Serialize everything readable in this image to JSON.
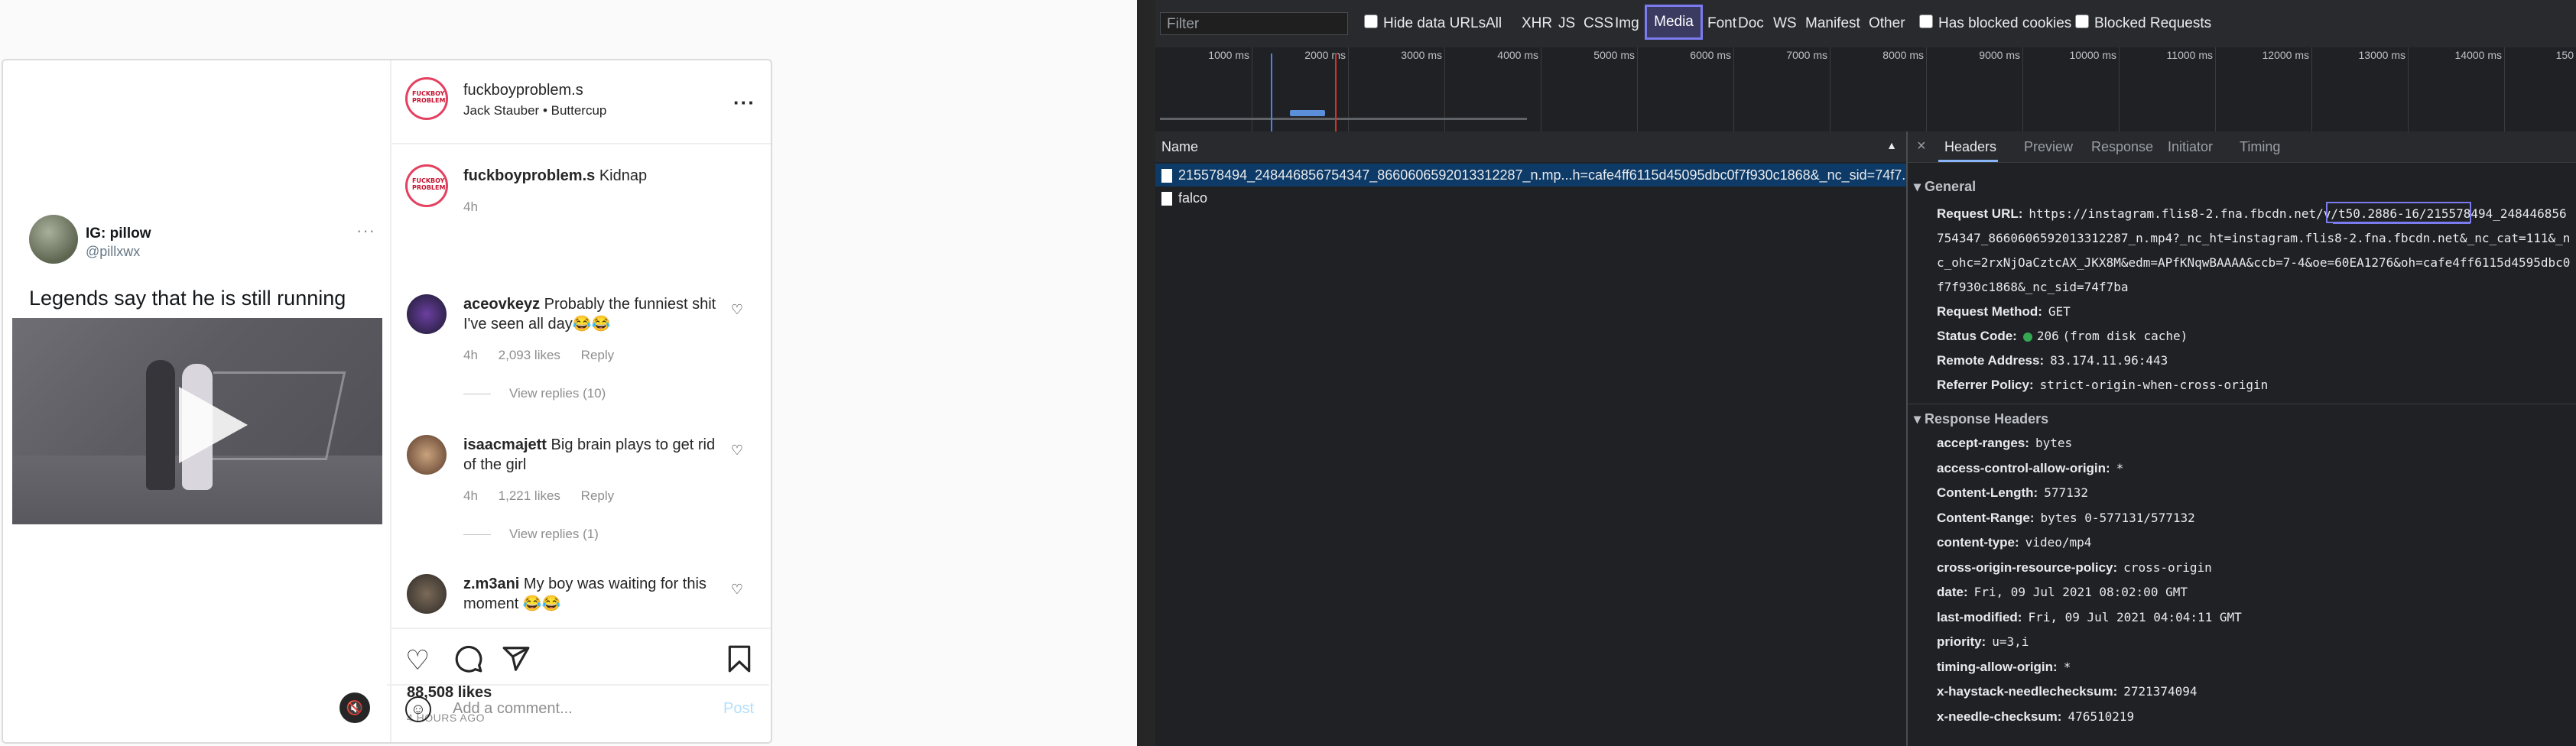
{
  "instagram": {
    "tweet": {
      "name": "IG: pillow",
      "handle": "@pillxwx",
      "more": "···",
      "text": "Legends say that he is still running"
    },
    "header": {
      "username": "fuckboyproblem.s",
      "subtitle": "Jack Stauber • Buttercup",
      "logo_text": "FUCKBOY PROBLEMS",
      "more": "···"
    },
    "caption": {
      "username": "fuckboyproblem.s",
      "text": "Kidnap",
      "time": "4h"
    },
    "comments": [
      {
        "username": "aceovkeyz",
        "text": "Probably the funniest shit I've seen all day😂😂",
        "time": "4h",
        "likes": "2,093 likes",
        "reply": "Reply",
        "replies": "View replies (10)"
      },
      {
        "username": "isaacmajett",
        "text": "Big brain plays to get rid of the girl",
        "time": "4h",
        "likes": "1,221 likes",
        "reply": "Reply",
        "replies": "View replies (1)"
      },
      {
        "username": "z.m3ani",
        "text": "My boy was waiting for this moment 😂😂"
      }
    ],
    "likes_count": "88,508 likes",
    "posted": "4 HOURS AGO",
    "add_comment_placeholder": "Add a comment...",
    "post_button": "Post",
    "icons": [
      "heart-icon",
      "comment-icon",
      "share-icon",
      "bookmark-icon",
      "emoji-icon",
      "mute-icon",
      "play-icon"
    ]
  },
  "devtools": {
    "filter_placeholder": "Filter",
    "hide_data_urls": "Hide data URLs",
    "type_filters": [
      "All",
      "XHR",
      "JS",
      "CSS",
      "Img",
      "Media",
      "Font",
      "Doc",
      "WS",
      "Manifest",
      "Other"
    ],
    "active_filter": "Media",
    "has_blocked_cookies": "Has blocked cookies",
    "blocked_requests": "Blocked Requests",
    "timeline_ticks": [
      "1000 ms",
      "2000 ms",
      "3000 ms",
      "4000 ms",
      "5000 ms",
      "6000 ms",
      "7000 ms",
      "8000 ms",
      "9000 ms",
      "10000 ms",
      "11000 ms",
      "12000 ms",
      "13000 ms",
      "14000 ms",
      "150"
    ],
    "list_header": "Name",
    "sort_glyph": "▲",
    "requests": [
      "215578494_248446856754347_8660606592013312287_n.mp...h=cafe4ff6115d45095dbc0f7f930c1868&_nc_sid=74f7...",
      "falco"
    ],
    "tabs": [
      "Headers",
      "Preview",
      "Response",
      "Initiator",
      "Timing"
    ],
    "active_tab": "Headers",
    "close_glyph": "×",
    "general_title": "General",
    "general": {
      "request_url_label": "Request URL:",
      "request_url": "https://instagram.flis8-2.fna.fbcdn.net/v/t50.2886-16/215578494_248446856754347_8660606592013312287_n.mp4?_nc_ht=instagram.flis8-2.fna.fbcdn.net&_nc_cat=111&_nc_ohc=2rxNjOaCztcAX_JKX8M&edm=APfKNqwBAAAA&ccb=7-4&oe=60EA1276&oh=cafe4ff6115d4595dbc0f7f930c1868&_nc_sid=74f7ba",
      "request_method_label": "Request Method:",
      "request_method": "GET",
      "status_code_label": "Status Code:",
      "status_code": "206",
      "status_note": "(from disk cache)",
      "remote_address_label": "Remote Address:",
      "remote_address": "83.174.11.96:443",
      "referrer_policy_label": "Referrer Policy:",
      "referrer_policy": "strict-origin-when-cross-origin"
    },
    "response_headers_title": "Response Headers",
    "response_headers": [
      {
        "k": "accept-ranges:",
        "v": "bytes"
      },
      {
        "k": "access-control-allow-origin:",
        "v": "*"
      },
      {
        "k": "Content-Length:",
        "v": "577132"
      },
      {
        "k": "Content-Range:",
        "v": "bytes 0-577131/577132"
      },
      {
        "k": "content-type:",
        "v": "video/mp4"
      },
      {
        "k": "cross-origin-resource-policy:",
        "v": "cross-origin"
      },
      {
        "k": "date:",
        "v": "Fri, 09 Jul 2021 08:02:00 GMT"
      },
      {
        "k": "last-modified:",
        "v": "Fri, 09 Jul 2021 04:04:11 GMT"
      },
      {
        "k": "priority:",
        "v": "u=3,i"
      },
      {
        "k": "timing-allow-origin:",
        "v": "*"
      },
      {
        "k": "x-haystack-needlechecksum:",
        "v": "2721374094"
      },
      {
        "k": "x-needle-checksum:",
        "v": "476510219"
      }
    ],
    "colors": {
      "accent": "#7b7bf0",
      "status_ok": "#34a853"
    }
  }
}
